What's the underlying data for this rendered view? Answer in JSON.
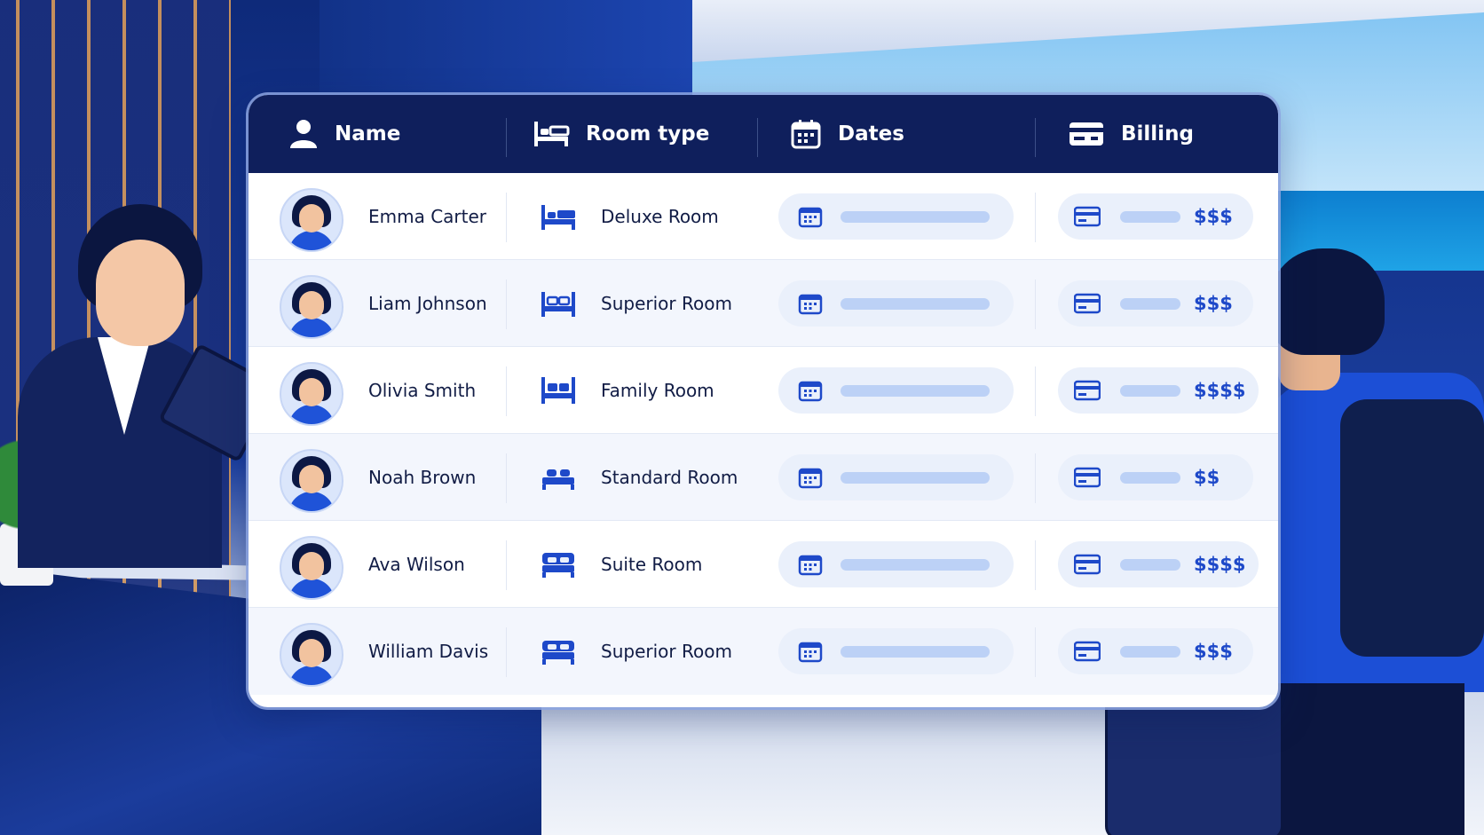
{
  "table": {
    "headers": {
      "name": "Name",
      "room_type": "Room type",
      "dates": "Dates",
      "billing": "Billing"
    },
    "header_icons": [
      "person-icon",
      "bed-icon",
      "calendar-icon",
      "credit-card-icon"
    ],
    "rows": [
      {
        "name": "Emma Carter",
        "room": "Deluxe Room",
        "price": "$$$"
      },
      {
        "name": "Liam Johnson",
        "room": "Superior Room",
        "price": "$$$"
      },
      {
        "name": "Olivia Smith",
        "room": "Family Room",
        "price": "$$$$"
      },
      {
        "name": "Noah Brown",
        "room": "Standard Room",
        "price": "$$"
      },
      {
        "name": "Ava Wilson",
        "room": "Suite Room",
        "price": "$$$$"
      },
      {
        "name": "William Davis",
        "room": "Superior Room",
        "price": "$$$"
      }
    ]
  },
  "colors": {
    "header_bg": "#0f1f5c",
    "accent": "#1e49c9",
    "pill_bg": "#eaf0fb",
    "bar": "#bcd1f6"
  }
}
